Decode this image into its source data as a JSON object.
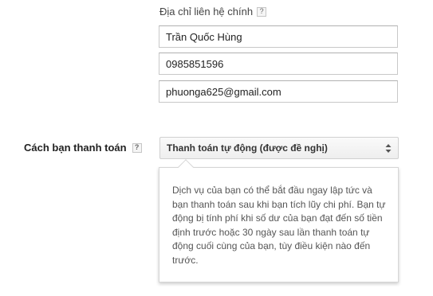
{
  "contact": {
    "label": "Địa chỉ liên hệ chính",
    "help_glyph": "?",
    "name_value": "Trần Quốc Hùng",
    "phone_value": "0985851596",
    "email_value": "phuonga625@gmail.com"
  },
  "payment": {
    "label": "Cách bạn thanh toán",
    "help_glyph": "?",
    "selected_option": "Thanh toán tự động (được đề nghị)",
    "tooltip_text": "Dịch vụ của bạn có thể bắt đầu ngay lập tức và bạn thanh toán sau khi bạn tích lũy chi phí. Bạn tự động bị tính phí khi số dư của bạn đạt đến số tiền định trước hoặc 30 ngày sau lần thanh toán tự động cuối cùng của bạn, tùy điều kiện nào đến trước."
  },
  "icons": {
    "help": "help-icon",
    "select_arrows": "select-arrows-icon"
  }
}
